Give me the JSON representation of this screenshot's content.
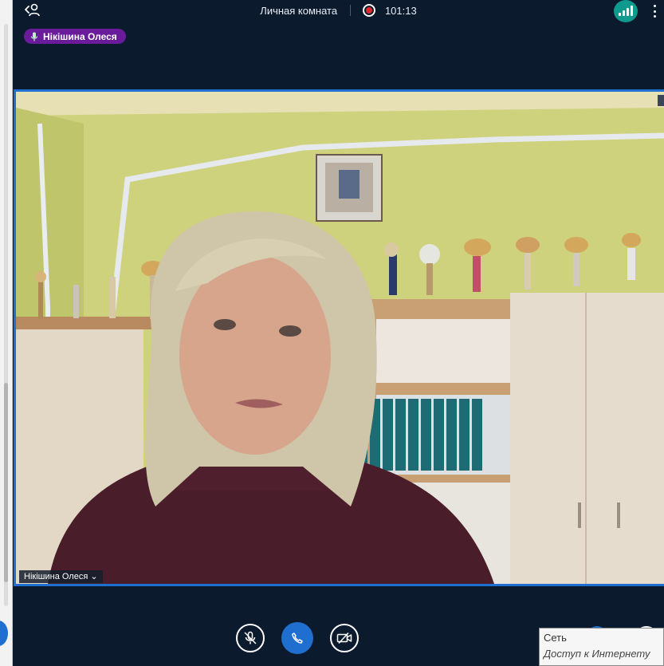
{
  "window": {
    "title": "Личная комната",
    "timer": "101:13"
  },
  "speaker": {
    "name": "Нікішина Олеся"
  },
  "video": {
    "participant_label": "Нікішина Олеся ⌄"
  },
  "network_tooltip": {
    "title": "Сеть",
    "status": "Доступ к Интернету"
  },
  "colors": {
    "background": "#0c1a2e",
    "accent_blue": "#1f6fd0",
    "speaker_chip": "#6a1b9a",
    "record_red": "#e0282f",
    "signal_teal": "#0f9a8e"
  },
  "icons": {
    "back": "chevron-left-user-icon",
    "record": "record-icon",
    "signal": "signal-bars-icon",
    "more": "kebab-menu-icon",
    "mic": "microphone-muted-icon",
    "call": "phone-icon",
    "camera": "camera-off-icon"
  }
}
